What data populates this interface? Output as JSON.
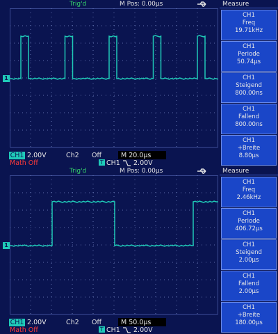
{
  "colors": {
    "background": "#0a1450",
    "trace": "#1fcab8",
    "trig_text": "#35d36a",
    "math_text": "#ff3a3a",
    "panel_box": "#1a46c8"
  },
  "screens": [
    {
      "trig": "Trig'd",
      "mpos": "M Pos: 0.00µs",
      "ch1_marker": "1",
      "ch1_label": "CH1",
      "ch1_volts": "2.00V",
      "ch2_label": "Ch2",
      "ch2_value": "Off",
      "timebase": "M 20.0µs",
      "math": "Math Off",
      "trig_source": "CH1",
      "trig_level": "2.00V",
      "measure_title": "Measure",
      "measurements": [
        {
          "ch": "CH1",
          "name": "Freq",
          "value": "19.71kHz"
        },
        {
          "ch": "CH1",
          "name": "Periode",
          "value": "50.74µs"
        },
        {
          "ch": "CH1",
          "name": "Steigend",
          "value": "800.00ns"
        },
        {
          "ch": "CH1",
          "name": "Fallend",
          "value": "800.00ns"
        },
        {
          "ch": "CH1",
          "name": "+Breite",
          "value": "8.80µs"
        }
      ]
    },
    {
      "trig": "Trig'd",
      "mpos": "M Pos: 0.00µs",
      "ch1_marker": "1",
      "ch1_label": "CH1",
      "ch1_volts": "2.00V",
      "ch2_label": "Ch2",
      "ch2_value": "Off",
      "timebase": "M 50.0µs",
      "math": "Math Off",
      "trig_source": "CH1",
      "trig_level": "2.00V",
      "measure_title": "Measure",
      "measurements": [
        {
          "ch": "CH1",
          "name": "Freq",
          "value": "2.46kHz"
        },
        {
          "ch": "CH1",
          "name": "Periode",
          "value": "406.72µs"
        },
        {
          "ch": "CH1",
          "name": "Steigend",
          "value": "2.00µs"
        },
        {
          "ch": "CH1",
          "name": "Fallend",
          "value": "2.00µs"
        },
        {
          "ch": "CH1",
          "name": "+Breite",
          "value": "180.00µs"
        }
      ]
    }
  ]
}
